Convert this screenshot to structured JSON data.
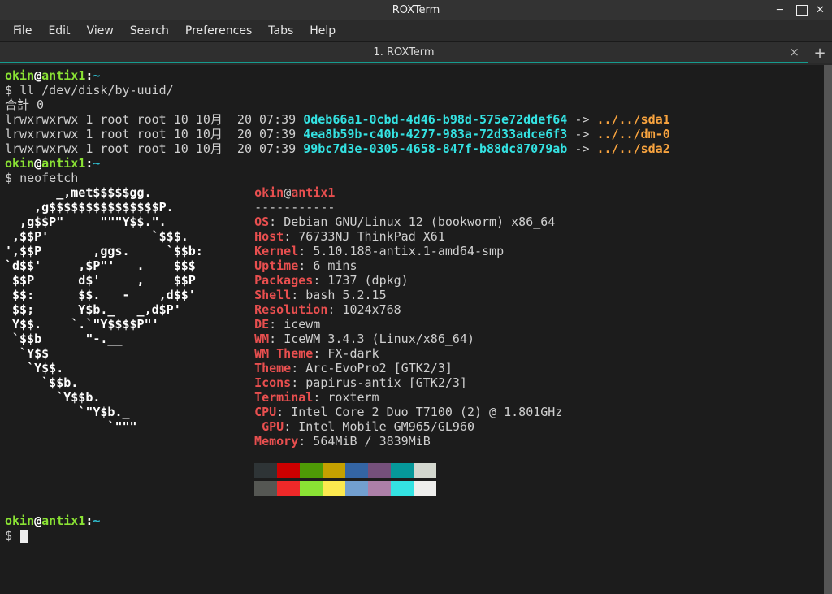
{
  "window": {
    "title": "ROXTerm"
  },
  "menu": {
    "file": "File",
    "edit": "Edit",
    "view": "View",
    "search": "Search",
    "preferences": "Preferences",
    "tabs": "Tabs",
    "help": "Help"
  },
  "tab": {
    "label": "1. ROXTerm",
    "close": "×",
    "new": "+"
  },
  "prompt": {
    "user": "okin",
    "at": "@",
    "host": "antix1",
    "sep": ":",
    "path": "~",
    "sym": "$"
  },
  "cmd": {
    "ll": "ll /dev/disk/by-uuid/",
    "neofetch": "neofetch"
  },
  "ll": {
    "total": "合計 0",
    "rows": [
      {
        "perm": "lrwxrwxrwx 1 root root 10 10月  20 07:39 ",
        "uuid": "0deb66a1-0cbd-4d46-b98d-575e72ddef64",
        "arrow": " -> ",
        "target": "../../sda1"
      },
      {
        "perm": "lrwxrwxrwx 1 root root 10 10月  20 07:39 ",
        "uuid": "4ea8b59b-c40b-4277-983a-72d33adce6f3",
        "arrow": " -> ",
        "target": "../../dm-0"
      },
      {
        "perm": "lrwxrwxrwx 1 root root 10 10月  20 07:39 ",
        "uuid": "99bc7d3e-0305-4658-847f-b88dc87079ab",
        "arrow": " -> ",
        "target": "../../sda2"
      }
    ]
  },
  "nf": {
    "logo": [
      "       _,met$$$$$gg.        ",
      "    ,g$$$$$$$$$$$$$$$P.     ",
      "  ,g$$P\"     \"\"\"Y$$.\".    ",
      " ,$$P'              `$$$.   ",
      "',$$P       ,ggs.     `$$b: ",
      "`d$$'     ,$P\"'   .    $$$ ",
      " $$P      d$'     ,    $$P  ",
      " $$:      $$.   -    ,d$$'  ",
      " $$;      Y$b._   _,d$P'    ",
      " Y$$.    `.`\"Y$$$$P\"'      ",
      " `$$b      \"-.__           ",
      "  `Y$$                      ",
      "   `Y$$.                    ",
      "     `$$b.                  ",
      "       `Y$$b.               ",
      "          `\"Y$b._           ",
      "              `\"\"\"          "
    ],
    "header_user": "okin",
    "header_host": "antix1",
    "dashes": "-----------",
    "labels": {
      "os": "OS",
      "host": "Host",
      "kernel": "Kernel",
      "uptime": "Uptime",
      "packages": "Packages",
      "shell": "Shell",
      "resolution": "Resolution",
      "de": "DE",
      "wm": "WM",
      "wm_theme": "WM Theme",
      "theme": "Theme",
      "icons": "Icons",
      "terminal": "Terminal",
      "cpu": "CPU",
      "gpu": "GPU",
      "memory": "Memory"
    },
    "values": {
      "os": "Debian GNU/Linux 12 (bookworm) x86_64",
      "host": "76733NJ ThinkPad X61",
      "kernel": "5.10.188-antix.1-amd64-smp",
      "uptime": "6 mins",
      "packages": "1737 (dpkg)",
      "shell": "bash 5.2.15",
      "resolution": "1024x768",
      "de": "icewm",
      "wm": "IceWM 3.4.3 (Linux/x86_64)",
      "wm_theme": "FX-dark",
      "theme": "Arc-EvoPro2 [GTK2/3]",
      "icons": "papirus-antix [GTK2/3]",
      "terminal": "roxterm",
      "cpu": "Intel Core 2 Duo T7100 (2) @ 1.801GHz",
      "gpu": "Intel Mobile GM965/GL960",
      "memory": "564MiB / 3839MiB"
    }
  },
  "colors": {
    "row1": [
      "#2e3436",
      "#cc0000",
      "#4e9a06",
      "#c4a000",
      "#3465a4",
      "#75507b",
      "#06989a",
      "#d3d7cf"
    ],
    "row2": [
      "#555753",
      "#ef2929",
      "#8ae234",
      "#fce94f",
      "#729fcf",
      "#ad7fa8",
      "#34e2e2",
      "#eeeeec"
    ]
  }
}
